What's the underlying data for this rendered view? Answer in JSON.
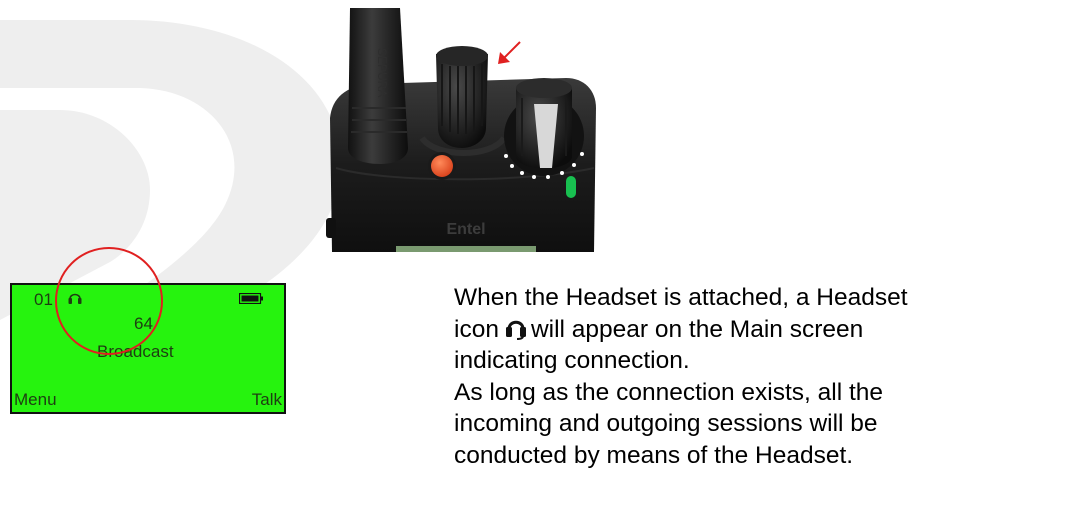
{
  "lcd": {
    "channel": "01",
    "number": "64",
    "group": "Broadcast",
    "left_softkey": "Menu",
    "right_softkey": "Talk",
    "background_color": "#26f30e"
  },
  "radio_photo": {
    "brand_label": "Entel"
  },
  "description": {
    "line1": "When the Headset is attached, a Headset",
    "line2_before_icon": "icon",
    "line2_after_icon": "will appear on the Main screen",
    "line3": "indicating connection.",
    "line4": "As long as the connection exists, all the",
    "line5": "incoming and outgoing sessions will be",
    "line6": "conducted by means of the Headset."
  },
  "icons": {
    "headset": "headset-icon",
    "battery": "battery-icon",
    "arrow": "red-arrow-icon"
  }
}
